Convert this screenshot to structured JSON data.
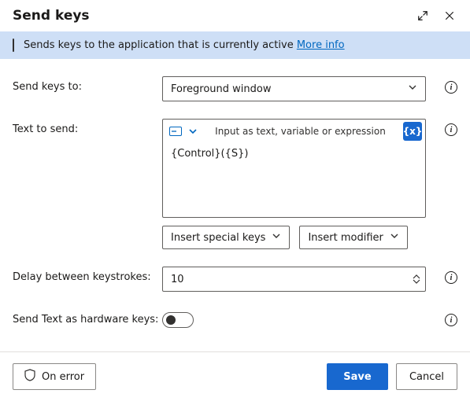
{
  "header": {
    "title": "Send keys"
  },
  "banner": {
    "text": "Sends keys to the application that is currently active ",
    "link_label": "More info"
  },
  "fields": {
    "send_to": {
      "label": "Send keys to:",
      "value": "Foreground window"
    },
    "text_to_send": {
      "label": "Text to send:",
      "placeholder": "Input as text, variable or expression",
      "fx_label": "{x}",
      "value": "{Control}({S})",
      "special_keys_label": "Insert special keys",
      "modifier_label": "Insert modifier"
    },
    "delay": {
      "label": "Delay between keystrokes:",
      "value": "10"
    },
    "hardware": {
      "label": "Send Text as hardware keys:",
      "value": false
    }
  },
  "footer": {
    "on_error": "On error",
    "save": "Save",
    "cancel": "Cancel"
  }
}
